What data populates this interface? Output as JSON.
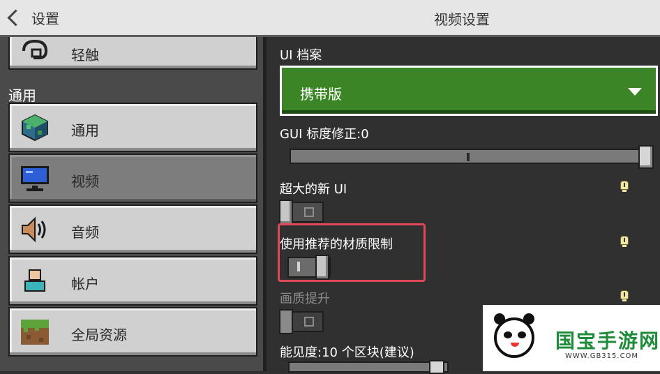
{
  "header": {
    "back_label": "设置",
    "title": "视频设置"
  },
  "sidebar": {
    "section_title": "通用",
    "items": [
      {
        "label": "轻触",
        "icon": "touch-icon"
      },
      {
        "label": "通用",
        "icon": "globe-icon"
      },
      {
        "label": "视频",
        "icon": "monitor-icon",
        "active": true
      },
      {
        "label": "音频",
        "icon": "speaker-icon"
      },
      {
        "label": "帐户",
        "icon": "account-icon"
      },
      {
        "label": "全局资源",
        "icon": "grass-block-icon"
      }
    ]
  },
  "main": {
    "ui_profile": {
      "label": "UI 档案",
      "value": "携带版"
    },
    "gui_scale": {
      "label": "GUI 标度修正:0",
      "value": 1.0
    },
    "extra_large_ui": {
      "label": "超大的新 UI",
      "on": false
    },
    "recommended_texture_limit": {
      "label": "使用推荐的材质限制",
      "on": true
    },
    "graphics_upgrade": {
      "label": "画质提升",
      "on": false,
      "disabled": true
    },
    "render_distance": {
      "label": "能见度:10 个区块(建议)"
    }
  },
  "watermark": {
    "title": "国宝手游网",
    "url": "WWW.GB315.COM"
  },
  "colors": {
    "accent_green": "#3c8527",
    "highlight_red": "#e0485a"
  }
}
